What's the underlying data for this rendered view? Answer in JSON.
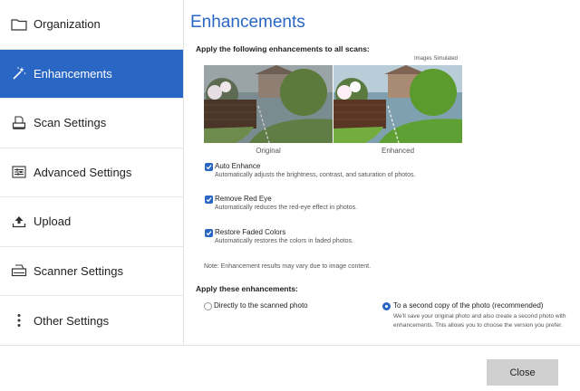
{
  "sidebar": {
    "items": [
      {
        "label": "Organization",
        "icon": "folder-icon",
        "active": false
      },
      {
        "label": "Enhancements",
        "icon": "magic-wand-icon",
        "active": true
      },
      {
        "label": "Scan Settings",
        "icon": "scanner-icon",
        "active": false
      },
      {
        "label": "Advanced Settings",
        "icon": "sliders-icon",
        "active": false
      },
      {
        "label": "Upload",
        "icon": "upload-icon",
        "active": false
      },
      {
        "label": "Scanner Settings",
        "icon": "scanner-icon",
        "active": false
      },
      {
        "label": "Other Settings",
        "icon": "vertical-dots-icon",
        "active": false
      }
    ]
  },
  "main": {
    "title": "Enhancements",
    "intro": "Apply the following enhancements to all scans:",
    "sim_note": "Images Simulated",
    "captions": {
      "original": "Original",
      "enhanced": "Enhanced"
    },
    "options": [
      {
        "title": "Auto Enhance",
        "desc": "Automatically adjusts the brightness, contrast, and saturation of photos.",
        "checked": true
      },
      {
        "title": "Remove Red Eye",
        "desc": "Automatically reduces the red-eye effect in photos.",
        "checked": true
      },
      {
        "title": "Restore Faded Colors",
        "desc": "Automatically restores the colors in faded photos.",
        "checked": true
      }
    ],
    "note": "Note: Enhancement results may vary due to image content.",
    "apply_heading": "Apply these enhancements:",
    "apply_options": [
      {
        "label": "Directly to the scanned photo",
        "selected": false
      },
      {
        "label": "To a second copy of the photo (recommended)",
        "desc": "We'll save your original photo and also create a second photo with enhancements. This allows you to choose the version you prefer.",
        "selected": true
      }
    ]
  },
  "footer": {
    "close_label": "Close"
  },
  "colors": {
    "accent": "#2a66c4",
    "button": "#cfcfcf"
  }
}
